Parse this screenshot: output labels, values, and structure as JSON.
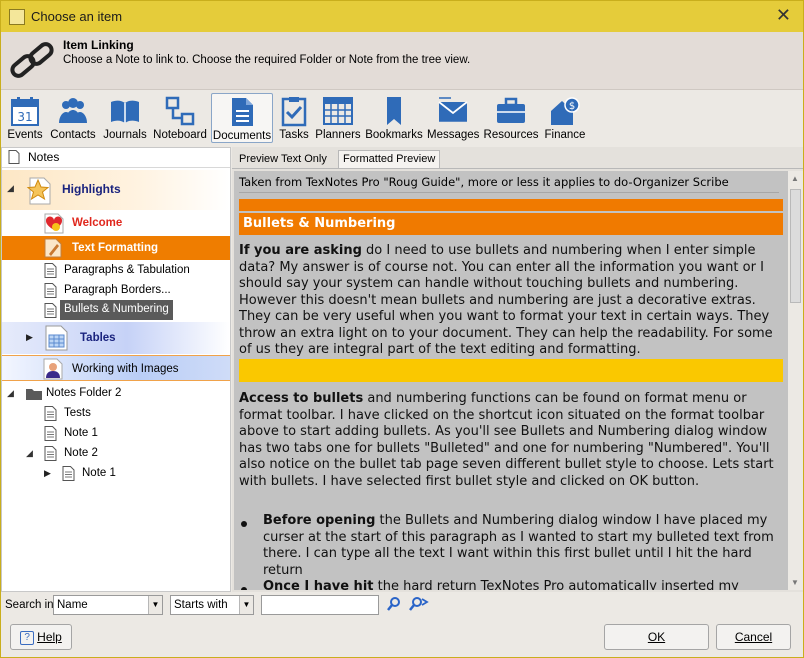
{
  "window": {
    "title": "Choose an item",
    "close_glyph": "✕"
  },
  "header": {
    "title": "Item Linking",
    "description": "Choose a Note to link to. Choose the required Folder or Note from the tree view.",
    "icon": "chain-link-icon"
  },
  "toolbar": [
    {
      "label": "Events",
      "icon": "calendar-icon",
      "badge": "31"
    },
    {
      "label": "Contacts",
      "icon": "people-icon"
    },
    {
      "label": "Journals",
      "icon": "book-icon"
    },
    {
      "label": "Noteboard",
      "icon": "noteboard-icon"
    },
    {
      "label": "Documents",
      "icon": "document-icon",
      "active": true
    },
    {
      "label": "Tasks",
      "icon": "clipboard-check-icon"
    },
    {
      "label": "Planners",
      "icon": "planner-grid-icon"
    },
    {
      "label": "Bookmarks",
      "icon": "bookmark-icon"
    },
    {
      "label": "Messages",
      "icon": "envelope-icon"
    },
    {
      "label": "Resources",
      "icon": "briefcase-icon"
    },
    {
      "label": "Finance",
      "icon": "finance-house-icon"
    }
  ],
  "tree": {
    "header": "Notes",
    "items": [
      {
        "label": "Highlights"
      },
      {
        "label": "Welcome"
      },
      {
        "label": "Text Formatting"
      },
      {
        "label": "Paragraphs & Tabulation"
      },
      {
        "label": "Paragraph Borders..."
      },
      {
        "label": "Bullets & Numbering"
      },
      {
        "label": "Tables"
      },
      {
        "label": "Working with Images"
      },
      {
        "label": "Notes Folder 2"
      },
      {
        "label": "Tests"
      },
      {
        "label": "Note 1"
      },
      {
        "label": "Note 2"
      },
      {
        "label": "Note 1"
      }
    ]
  },
  "preview_tabs": [
    "Preview Text Only",
    "Formatted Preview"
  ],
  "preview": {
    "intro": "Taken from TexNotes Pro \"Roug Guide\", more or less it applies to do-Organizer Scribe",
    "heading": "Bullets & Numbering",
    "para1_bold": "If you are asking",
    "para1_rest": " do I need to use bullets and numbering when I enter simple data? My answer is of course not. You can enter all the information you want or I should say your system can handle without touching bullets and numbering. However this doesn't mean bullets and numbering are just a decorative extras. They can be very useful when you want to format your text in certain ways. They throw an extra light on to your document. They can help the readability. For some of us they are integral part of the text editing and formatting.",
    "para2_bold": "Access to bullets",
    "para2_rest": " and numbering functions can be found on format menu or format toolbar. I have clicked on the shortcut icon situated on the format toolbar above to start adding bullets. As you'll see Bullets and Numbering dialog window has two tabs one for bullets \"Bulleted\" and one for numbering \"Numbered\". You'll also notice on the bullet tab page seven different bullet style to choose. Lets start with bullets. I have selected first bullet style and clicked on OK button.",
    "bullet1_bold": "Before opening",
    "bullet1_rest": " the Bullets and Numbering dialog window I have placed my curser at the start of this paragraph as I wanted to start my bulleted text from there. I can type all the text I want within this first bullet until I hit the hard return",
    "bullet2_bold": "Once I have hit",
    "bullet2_rest": " the hard return TexNotes Pro automatically inserted my"
  },
  "search": {
    "label": "Search in",
    "field": "Name",
    "mode": "Starts with",
    "value": ""
  },
  "buttons": {
    "help": "Help",
    "ok": "OK",
    "cancel": "Cancel"
  },
  "colors": {
    "accent_orange": "#f07a00",
    "accent_yellow": "#fac800",
    "title_bar": "#e5cc3a"
  }
}
